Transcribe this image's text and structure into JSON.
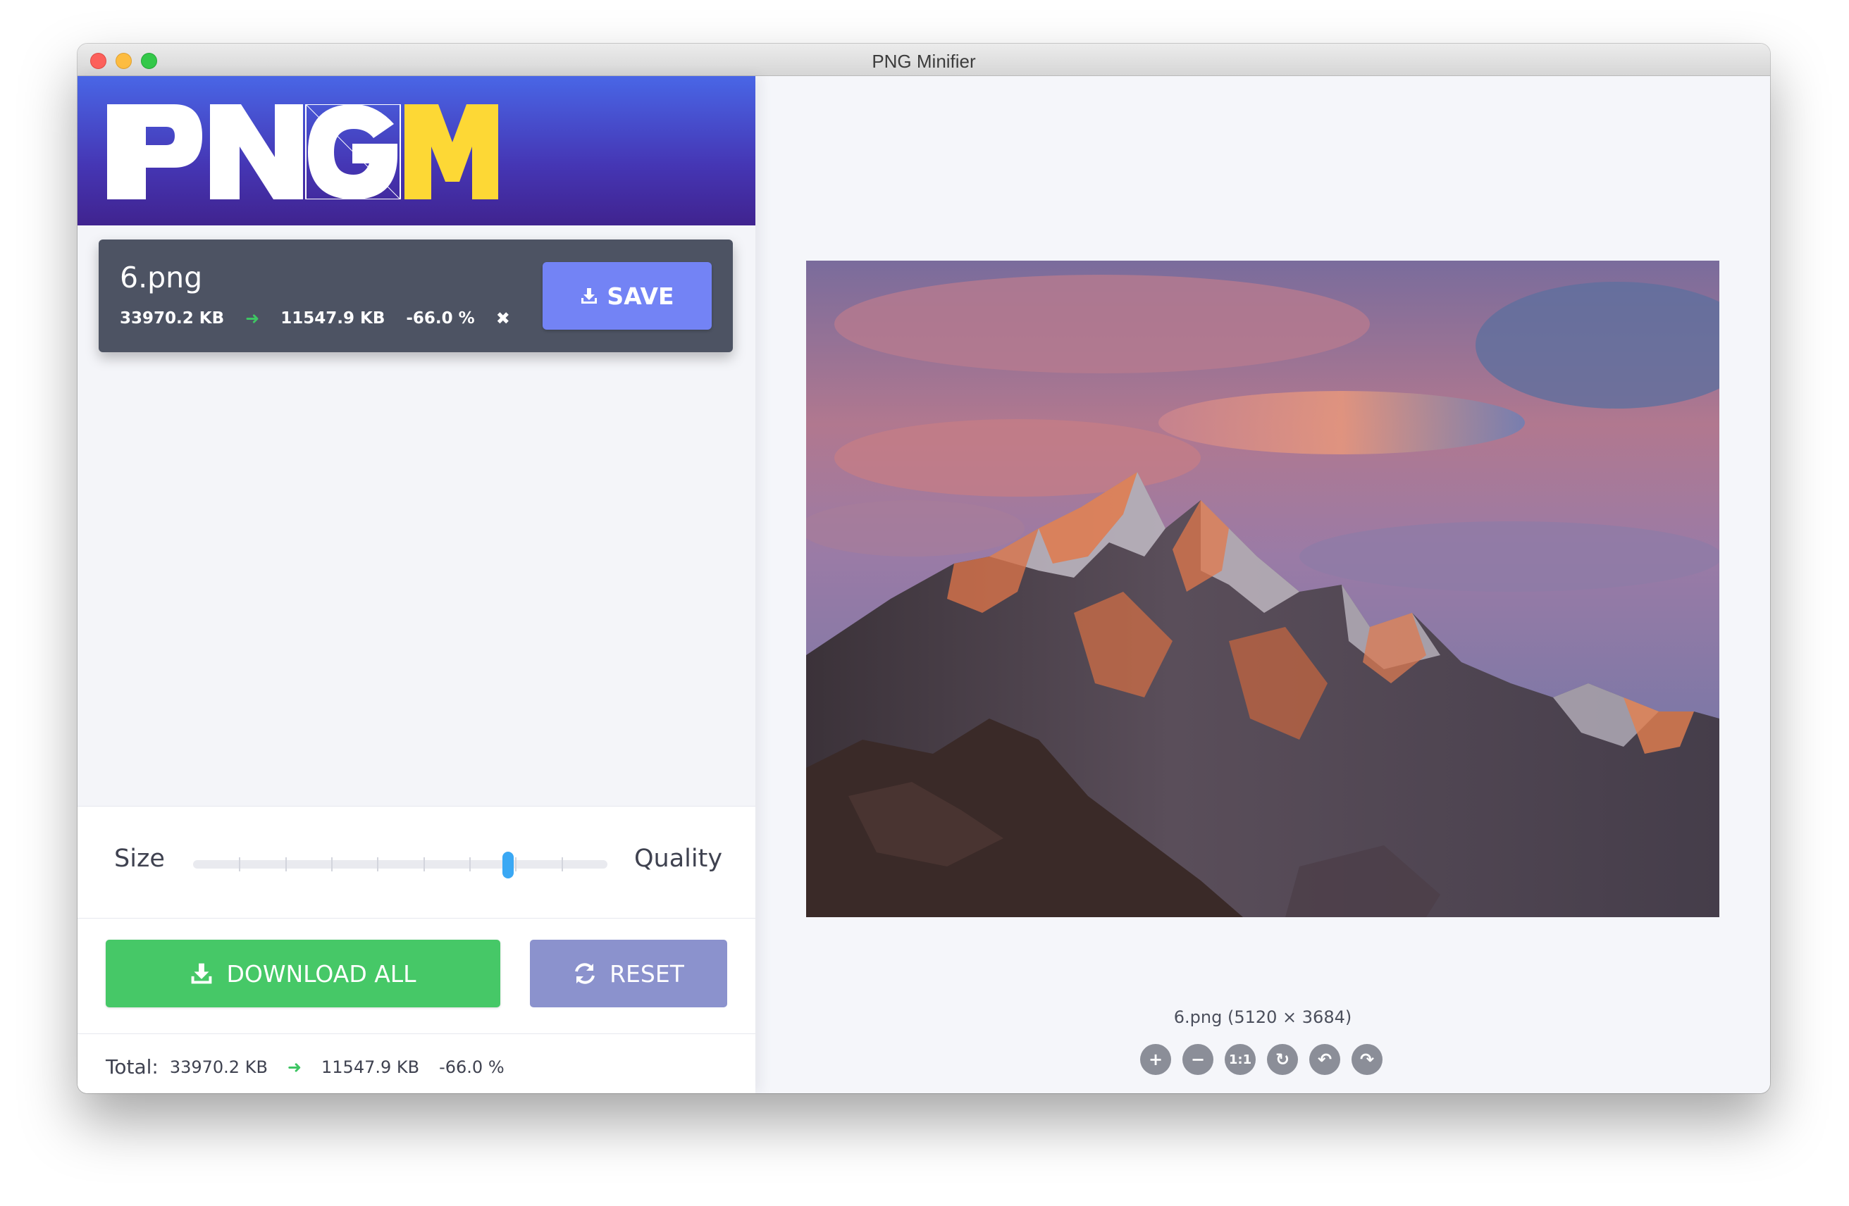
{
  "window": {
    "title": "PNG Minifier"
  },
  "logo": {
    "text": "PNGM"
  },
  "file": {
    "name": "6.png",
    "original_size": "33970.2 KB",
    "compressed_size": "11547.9 KB",
    "reduction": "-66.0 %",
    "save_label": "SAVE"
  },
  "slider": {
    "left_label": "Size",
    "right_label": "Quality",
    "value_fraction": 0.76,
    "ticks": 9
  },
  "actions": {
    "download_all_label": "DOWNLOAD ALL",
    "reset_label": "RESET"
  },
  "total": {
    "label": "Total:",
    "original_size": "33970.2 KB",
    "compressed_size": "11547.9 KB",
    "reduction": "-66.0 %"
  },
  "preview": {
    "caption": "6.png (5120 × 3684)",
    "zoom_buttons": [
      {
        "name": "zoom-in-icon",
        "glyph": "+"
      },
      {
        "name": "zoom-out-icon",
        "glyph": "−"
      },
      {
        "name": "actual-size-icon",
        "glyph": "1:1"
      },
      {
        "name": "refresh-icon",
        "glyph": "↻"
      },
      {
        "name": "undo-icon",
        "glyph": "↶"
      },
      {
        "name": "redo-icon",
        "glyph": "↷"
      }
    ]
  },
  "colors": {
    "accent_blue": "#7383f5",
    "download_green": "#46c867",
    "reset_purple": "#8b92cd",
    "logo_yellow": "#fdd835",
    "slider_thumb": "#3aa8f4"
  }
}
